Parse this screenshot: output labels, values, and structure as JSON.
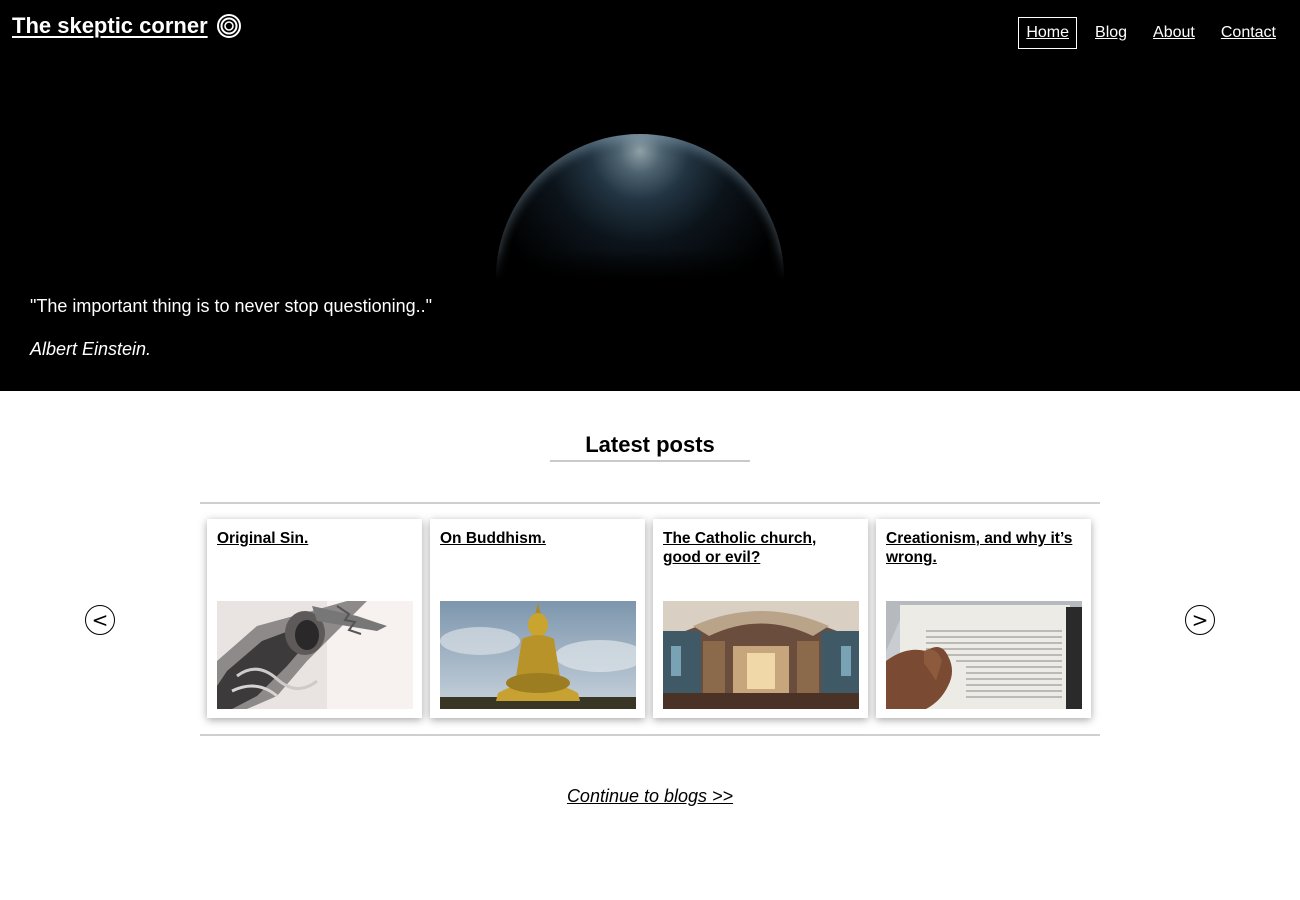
{
  "header": {
    "brand_title": "The skeptic corner",
    "nav": [
      {
        "label": "Home",
        "active": true
      },
      {
        "label": "Blog",
        "active": false
      },
      {
        "label": "About",
        "active": false
      },
      {
        "label": "Contact",
        "active": false
      }
    ]
  },
  "hero": {
    "quote": "\"The important thing is to never stop questioning..\"",
    "author": "Albert Einstein."
  },
  "latest": {
    "title": "Latest posts",
    "prev_label": "<",
    "next_label": ">",
    "posts": [
      {
        "title": "Original Sin.",
        "image": "crucifix-statue-photo"
      },
      {
        "title": "On Buddhism.",
        "image": "golden-buddha-statue-photo"
      },
      {
        "title": "The Catholic church, good or evil?",
        "image": "cathedral-interior-photo"
      },
      {
        "title": "Creationism, and why it’s wrong.",
        "image": "bible-genesis-photo"
      }
    ]
  },
  "footer": {
    "continue_label": "Continue to blogs >>"
  },
  "colors": {
    "hero_bg": "#000000",
    "page_bg": "#ffffff",
    "rule": "#cfcfcf"
  }
}
